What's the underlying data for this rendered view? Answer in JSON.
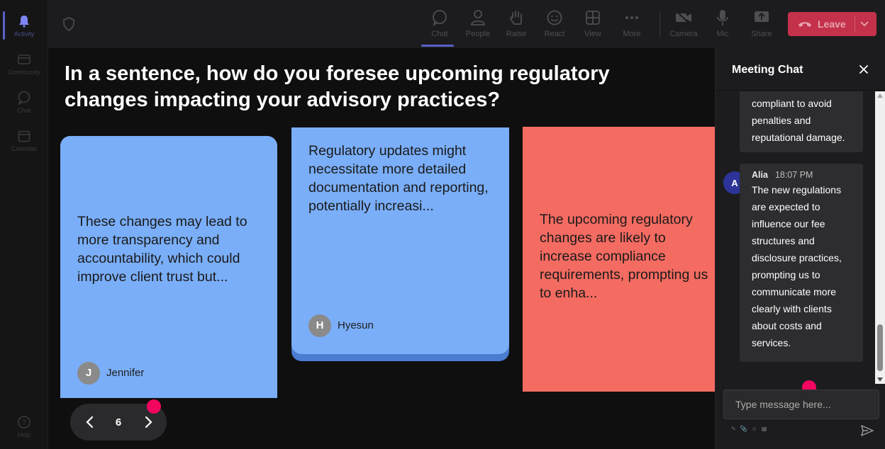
{
  "rail": {
    "items": [
      {
        "label": "Activity",
        "icon": "bell-icon"
      },
      {
        "label": "Community",
        "icon": "community-icon"
      },
      {
        "label": "Chat",
        "icon": "chat-icon"
      },
      {
        "label": "Calendar",
        "icon": "calendar-icon"
      }
    ],
    "help_label": "Help"
  },
  "toolbar": {
    "chat": "Chat",
    "people": "People",
    "raise": "Raise",
    "react": "React",
    "view": "View",
    "more": "More",
    "camera": "Camera",
    "mic": "Mic",
    "share": "Share",
    "leave": "Leave"
  },
  "stage": {
    "question": "In a sentence, how do you foresee upcoming regulatory changes impacting your advisory practices?",
    "cards": [
      {
        "text": "These changes may lead to more transparency and accountability, which could improve client trust but...",
        "author": "Jennifer",
        "initial": "J",
        "color": "#7aaef8"
      },
      {
        "text": "Regulatory updates might necessitate more detailed documentation and reporting, potentially increasi...",
        "author": "Hyesun",
        "initial": "H",
        "color": "#7aaef8"
      },
      {
        "text": "The upcoming regulatory changes are likely to increase compliance requirements, prompting us to enha...",
        "color": "#f46b61"
      }
    ],
    "page_number": "6"
  },
  "chat": {
    "title": "Meeting Chat",
    "messages": [
      {
        "text_lines": [
          "compliant to avoid",
          "penalties and",
          "reputational damage."
        ]
      },
      {
        "author": "Alia",
        "initial": "A",
        "time": "18:07 PM",
        "text_lines": [
          "The new regulations",
          "are expected to",
          "influence our fee",
          "structures and",
          "disclosure practices,",
          "prompting us to",
          "communicate more",
          "clearly with clients",
          "about costs and",
          "services."
        ]
      }
    ],
    "input_placeholder": "Type message here..."
  },
  "colors": {
    "accent": "#5b5fc7",
    "leave": "#c4314b",
    "card_blue": "#7aaef8",
    "card_red": "#f46b61",
    "marker": "#f3065f"
  }
}
